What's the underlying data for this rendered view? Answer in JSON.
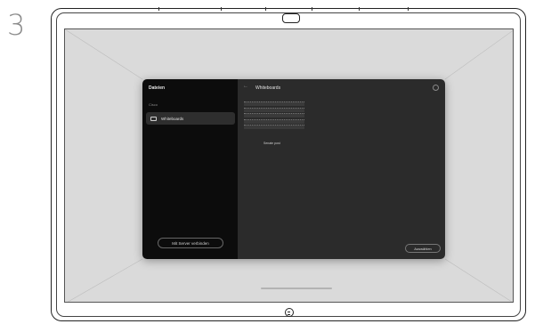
{
  "step": {
    "number": "3"
  },
  "dialog": {
    "sidebar": {
      "title": "Dateien",
      "section_label": "Cisco",
      "items": [
        {
          "label": "Whiteboards",
          "icon": "folder-icon",
          "selected": true
        }
      ],
      "connect_button": "Mit Server verbinden"
    },
    "main": {
      "back_icon": "back-arrow-icon",
      "title": "Whiteboards",
      "file_caption": "Senate post",
      "select_button": "Auswählen"
    }
  },
  "colors": {
    "screen_bg": "#dadada",
    "sidebar_bg": "#0c0c0c",
    "main_bg": "#2b2b2b",
    "selected_item_bg": "#2e2e2e"
  }
}
